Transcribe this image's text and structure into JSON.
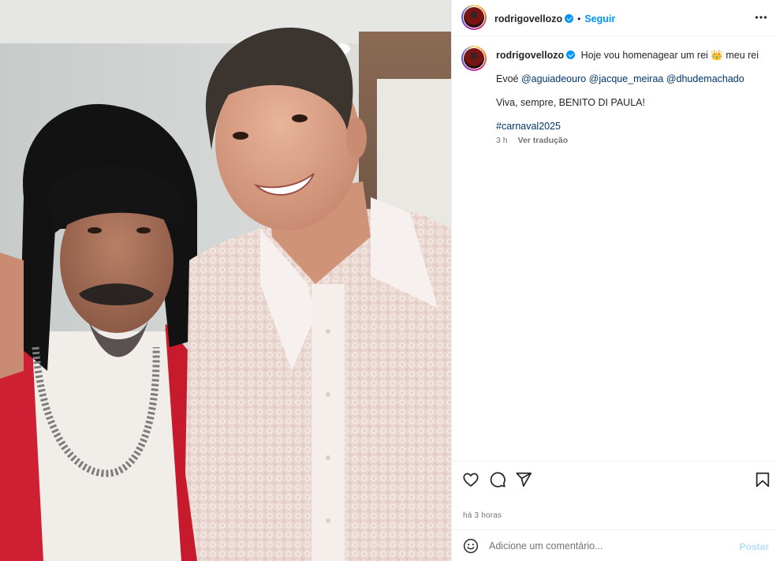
{
  "post": {
    "username": "rodrigovellozo",
    "follow_label": "Seguir",
    "caption": {
      "line1_text": "Hoje vou homenagear um rei",
      "line1_emoji": "👑",
      "line1_tail": "meu rei",
      "line2_prefix": "Evoé",
      "mentions": [
        "@aguiadeouro",
        "@jacque_meiraa",
        "@dhudemachado"
      ],
      "line3": "Viva, sempre, BENITO DI PAULA!",
      "hashtag": "#carnaval2025"
    },
    "caption_time": "3 h",
    "translate_label": "Ver tradução",
    "time_ago": "há 3 horas"
  },
  "comment": {
    "placeholder": "Adicione um comentário...",
    "post_label": "Postar"
  },
  "icons": {
    "more": "more-options-icon",
    "like": "heart-icon",
    "comment": "comment-icon",
    "share": "send-icon",
    "save": "bookmark-icon",
    "emoji": "emoji-icon",
    "verified": "verified-badge-icon"
  },
  "colors": {
    "link": "#0095f6",
    "mention": "#00376b",
    "text": "#262626",
    "muted": "#737373",
    "post_disabled": "#b2dffc"
  }
}
